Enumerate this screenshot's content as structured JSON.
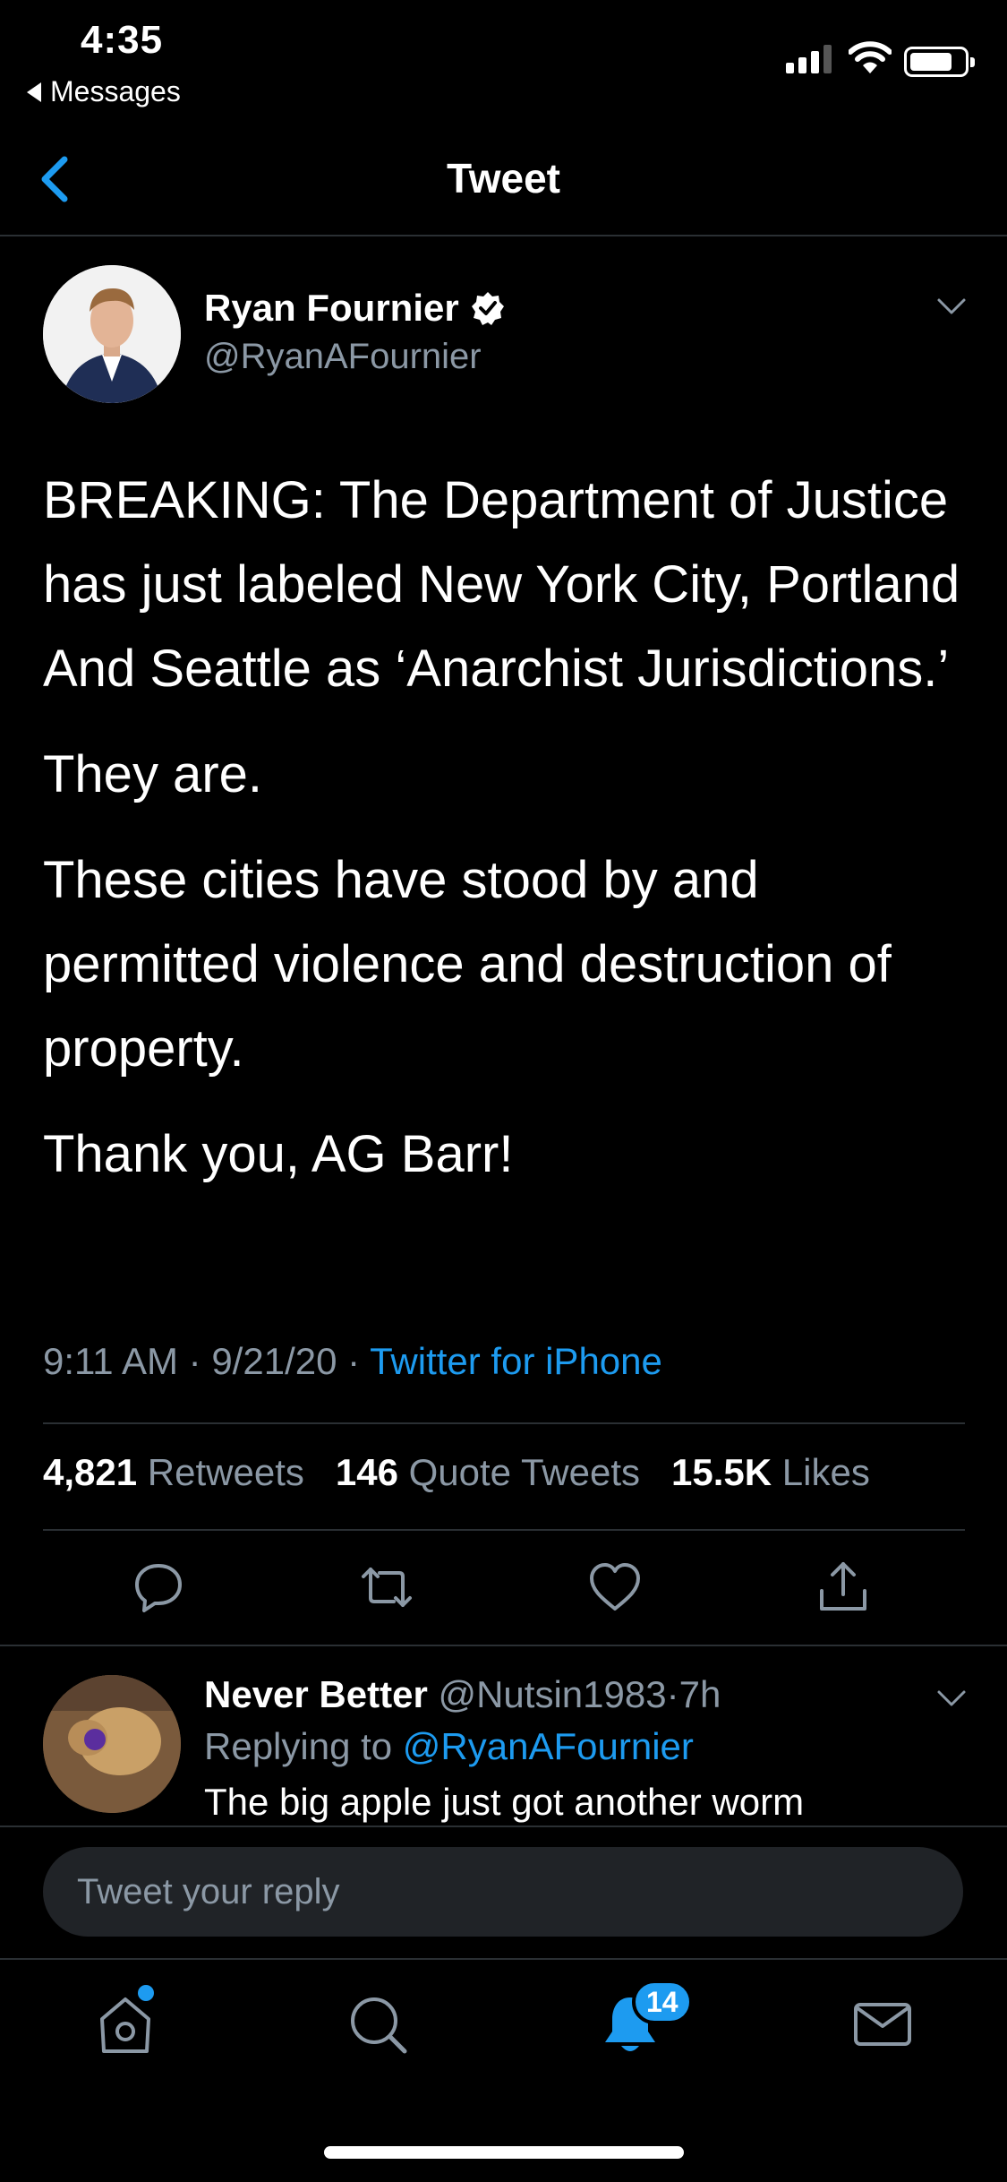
{
  "status_bar": {
    "time": "4:35",
    "back_app": "Messages",
    "signal_bars": 3,
    "battery_level": 0.75
  },
  "nav": {
    "title": "Tweet"
  },
  "tweet": {
    "author_name": "Ryan Fournier",
    "author_handle": "@RyanAFournier",
    "verified": true,
    "paragraphs": [
      "BREAKING: The Department of Justice has just labeled New York City, Portland And Seattle as ‘Anarchist Jurisdictions.’",
      "They are.",
      "These cities have stood by and permitted violence and destruction of property.",
      "Thank you, AG Barr!"
    ],
    "time": "9:11 AM",
    "date": "9/21/20",
    "source": "Twitter for iPhone",
    "sep": "·",
    "retweets_count": "4,821",
    "retweets_label": "Retweets",
    "quotes_count": "146",
    "quotes_label": "Quote Tweets",
    "likes_count": "15.5K",
    "likes_label": "Likes"
  },
  "reply": {
    "author_name": "Never Better",
    "author_handle": "@Nutsin1983",
    "age": "7h",
    "replying_prefix": "Replying to",
    "replying_to": "@RyanAFournier",
    "text": "The big apple just got another worm"
  },
  "reply_box": {
    "placeholder": "Tweet your reply"
  },
  "tab_bar": {
    "notifications_badge": "14"
  },
  "colors": {
    "background": "#000000",
    "accent": "#1d9bf0",
    "muted": "#8b98a5",
    "divider": "#2a2f33"
  }
}
